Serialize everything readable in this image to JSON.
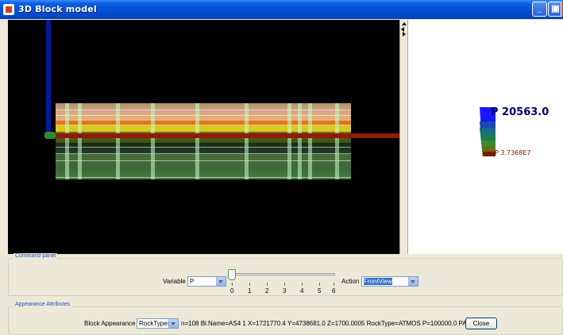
{
  "window": {
    "title": "3D Block model",
    "buttons": [
      "minimize",
      "maximize",
      "close"
    ]
  },
  "legend": {
    "top_label": "P 20563.0",
    "bottom_label": "P 3.7368E7",
    "colors": [
      "#1010ff",
      "#1a4cc0",
      "#1e7a70",
      "#228a3a",
      "#5a8a20",
      "#8a4a10",
      "#7a1a08"
    ]
  },
  "command_panel": {
    "title": "Command panel",
    "variable_label": "Variable",
    "variable_value": "P",
    "slider_value": 0,
    "slider_ticks": [
      "0",
      "1",
      "2",
      "3",
      "4",
      "5",
      "6"
    ],
    "action_label": "Action",
    "action_value": "FrontView"
  },
  "appearance": {
    "title": "Appearance Attributes",
    "block_appearance_label": "Block Appearance",
    "block_appearance_value": "RockTypes",
    "info_text": "n=108  Bl.Name=AS4 1 X=1721770.4 Y=4738681.0 Z=1700.0005 RockType=ATMOS P=100000.0 PA",
    "close_label": "Close"
  },
  "colors": {
    "titlebar": "#0552d8",
    "view_background": "#000000",
    "window_background": "#ece9d8",
    "group_title": "#1c4fc0"
  }
}
